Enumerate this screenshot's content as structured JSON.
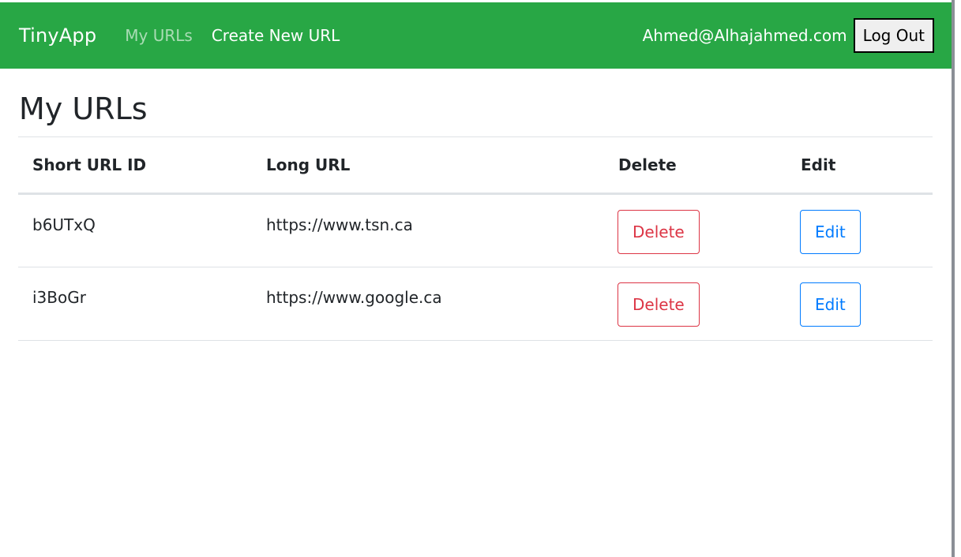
{
  "navbar": {
    "brand": "TinyApp",
    "links": [
      {
        "label": "My URLs",
        "active": true
      },
      {
        "label": "Create New URL",
        "active": false
      }
    ],
    "user_email": "Ahmed@Alhajahmed.com",
    "logout_label": "Log Out",
    "background_color": "#28a745"
  },
  "main": {
    "title": "My URLs",
    "table": {
      "headers": [
        "Short URL ID",
        "Long URL",
        "Delete",
        "Edit"
      ],
      "rows": [
        {
          "short_id": "b6UTxQ",
          "long_url": "https://www.tsn.ca",
          "delete_label": "Delete",
          "edit_label": "Edit"
        },
        {
          "short_id": "i3BoGr",
          "long_url": "https://www.google.ca",
          "delete_label": "Delete",
          "edit_label": "Edit"
        }
      ]
    }
  },
  "colors": {
    "delete": "#dc3545",
    "edit": "#007bff"
  }
}
